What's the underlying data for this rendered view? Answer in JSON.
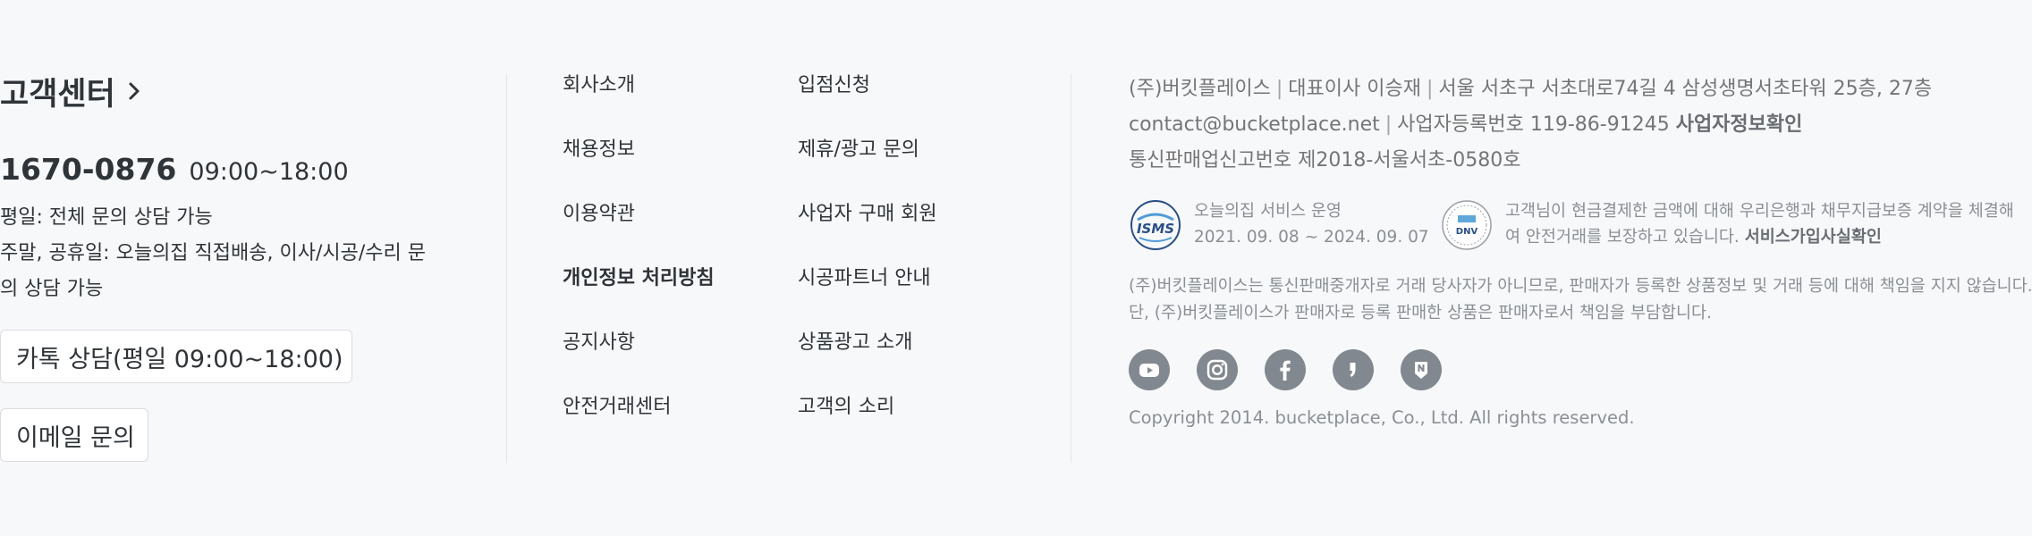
{
  "customer_center": {
    "title": "고객센터",
    "phone": "1670-0876",
    "hours": "09:00~18:00",
    "desc_lines": [
      "평일: 전체 문의 상담 가능",
      "주말, 공휴일: 오늘의집 직접배송, 이사/시공/수리 문",
      "의 상담 가능"
    ],
    "kakao_button": "카톡 상담(평일 09:00~18:00)",
    "email_button": "이메일 문의"
  },
  "links": {
    "col1": [
      {
        "label": "회사소개",
        "bold": false
      },
      {
        "label": "채용정보",
        "bold": false
      },
      {
        "label": "이용약관",
        "bold": false
      },
      {
        "label": "개인정보 처리방침",
        "bold": true
      },
      {
        "label": "공지사항",
        "bold": false
      },
      {
        "label": "안전거래센터",
        "bold": false
      }
    ],
    "col2": [
      {
        "label": "입점신청",
        "bold": false
      },
      {
        "label": "제휴/광고 문의",
        "bold": false
      },
      {
        "label": "사업자 구매 회원",
        "bold": false
      },
      {
        "label": "시공파트너 안내",
        "bold": false
      },
      {
        "label": "상품광고 소개",
        "bold": false
      },
      {
        "label": "고객의 소리",
        "bold": false
      }
    ]
  },
  "company": {
    "name": "(주)버킷플레이스",
    "ceo": "대표이사 이승재",
    "address": "서울 서초구 서초대로74길 4 삼성생명서초타워 25층, 27층",
    "email": "contact@bucketplace.net",
    "biz_no": "사업자등록번호 119-86-91245",
    "biz_info_link": "사업자정보확인",
    "mail_order_no": "통신판매업신고번호 제2018-서울서초-0580호"
  },
  "certs": {
    "isms": {
      "logo_text": "ISMS",
      "line1": "오늘의집 서비스 운영",
      "line2": "2021. 09. 08 ~ 2024. 09. 07"
    },
    "dnv": {
      "logo_text": "DNV",
      "line1": "고객님이 현금결제한 금액에 대해 우리은행과 채무지급보증 계약을 체결해",
      "line2": "여 안전거래를 보장하고 있습니다.",
      "link": "서비스가입사실확인"
    }
  },
  "disclaimer": [
    "(주)버킷플레이스는 통신판매중개자로 거래 당사자가 아니므로, 판매자가 등록한 상품정보 및 거래 등에 대해 책임을 지지 않습니다.",
    "단, (주)버킷플레이스가 판매자로 등록 판매한 상품은 판매자로서 책임을 부담합니다."
  ],
  "social_icons": [
    "youtube-icon",
    "instagram-icon",
    "facebook-icon",
    "kakao-story-icon",
    "naver-post-icon"
  ],
  "copyright": "Copyright 2014. bucketplace, Co., Ltd. All rights reserved.",
  "colors": {
    "background": "#f7f8fa",
    "text_primary": "#2f3438",
    "text_secondary": "#757575",
    "icon_gray": "#82888f"
  }
}
